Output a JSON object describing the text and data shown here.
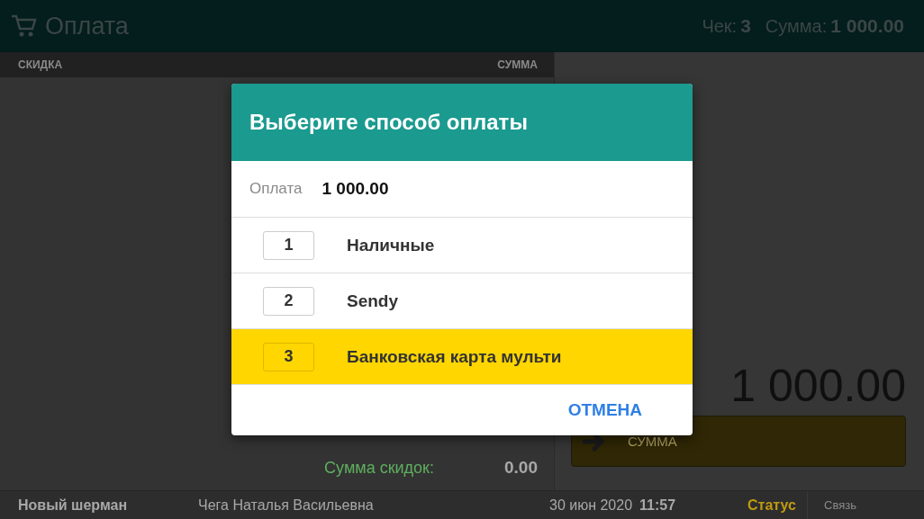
{
  "header": {
    "title": "Оплата",
    "check_label": "Чек:",
    "check_number": "3",
    "sum_label": "Сумма:",
    "sum_value": "1 000.00"
  },
  "table": {
    "columns": [
      "СКИДКА",
      "СУММА"
    ]
  },
  "summary": [
    {
      "label": "Сумма скидок:",
      "value": "0.00"
    }
  ],
  "total": "1 000.00",
  "pay_button": {
    "label": "СУММА"
  },
  "status_bar": {
    "shop": "Новый шерман",
    "cashier": "Чега Наталья Васильевна",
    "date": "30 июн 2020",
    "time": "11:57",
    "status": "Статус",
    "link": "Связь"
  },
  "dialog": {
    "title": "Выберите способ оплаты",
    "amount_label": "Оплата",
    "amount": "1 000.00",
    "options": [
      {
        "key": "1",
        "label": "Наличные",
        "selected": false
      },
      {
        "key": "2",
        "label": "Sendy",
        "selected": false
      },
      {
        "key": "3",
        "label": "Банковская карта мульти",
        "selected": true
      }
    ],
    "cancel": "ОТМЕНА"
  }
}
